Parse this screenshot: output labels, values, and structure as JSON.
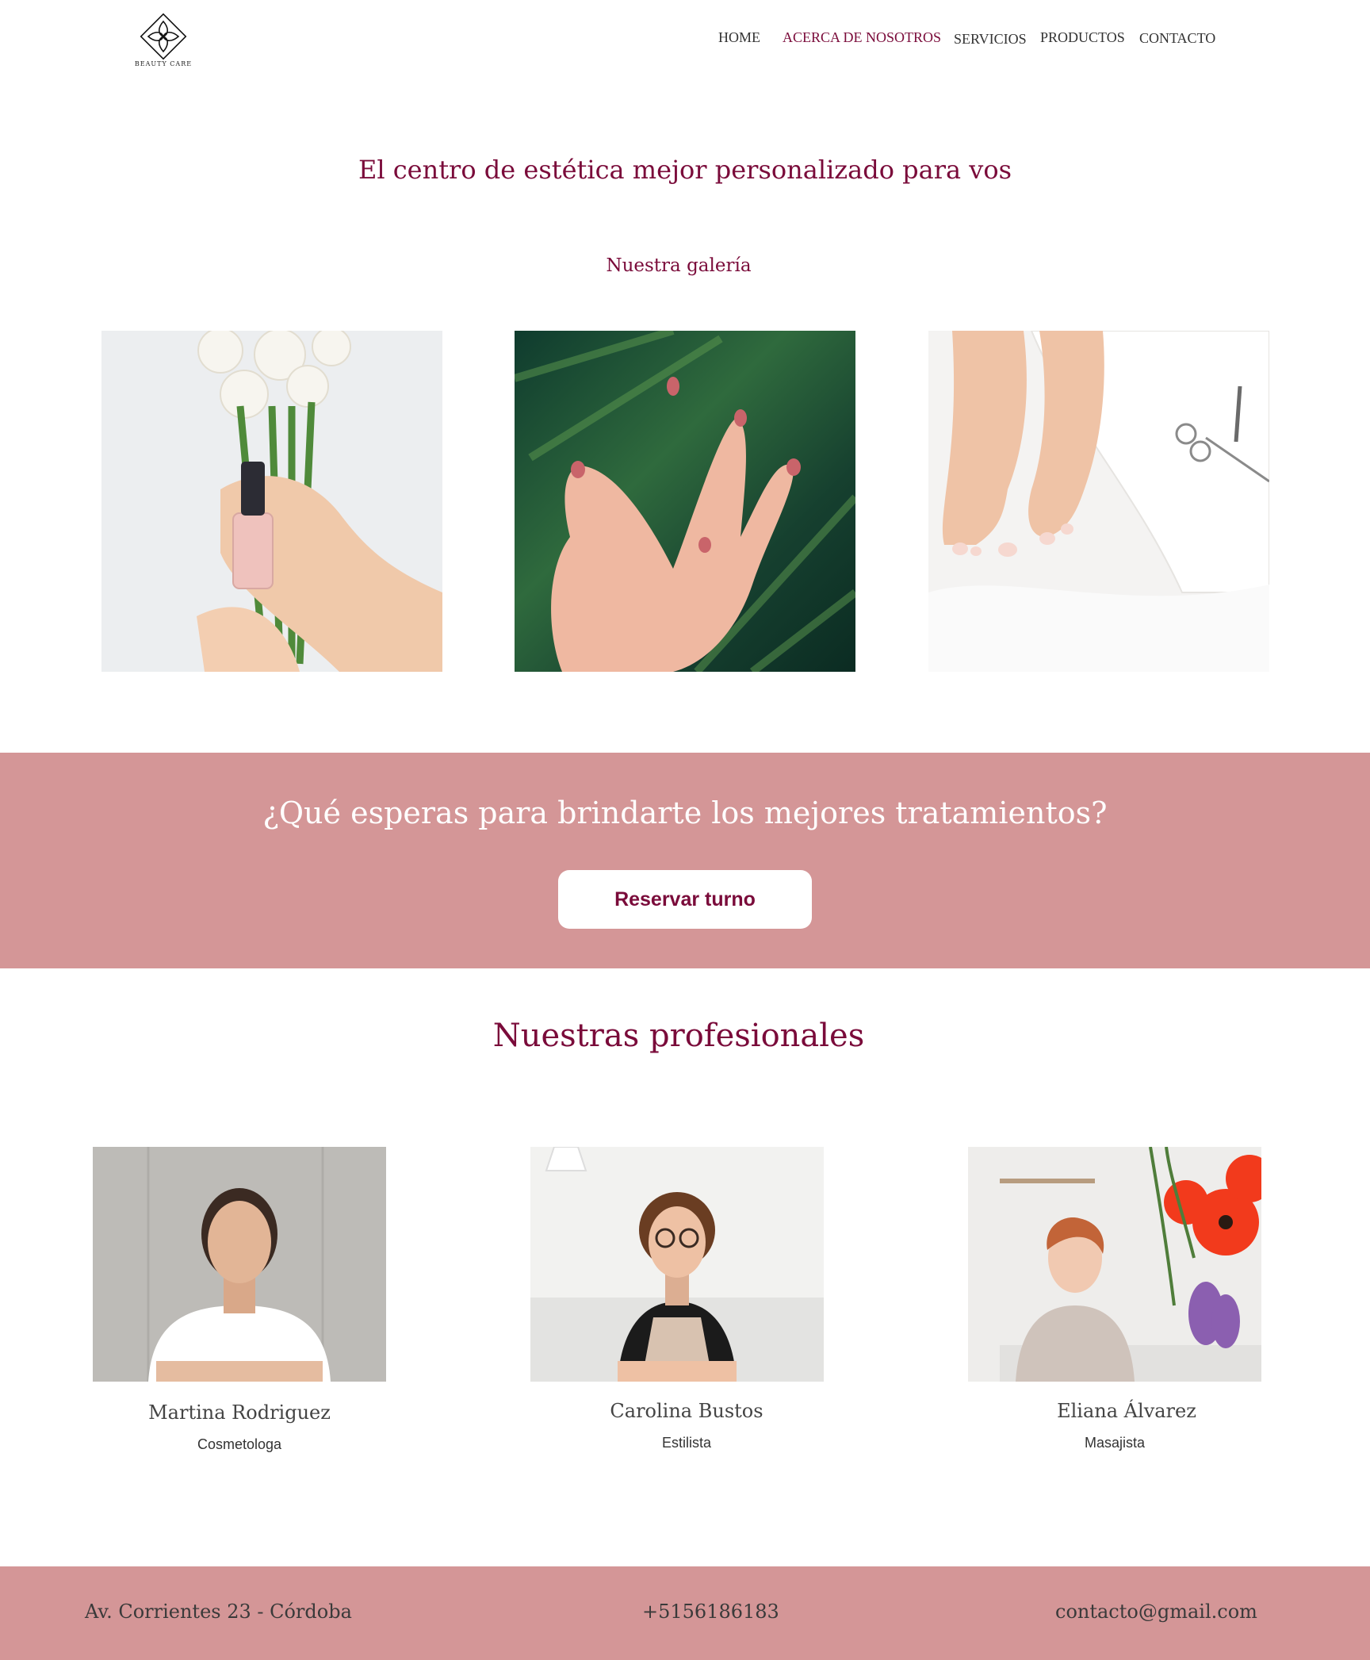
{
  "brand": {
    "logo_text": "BEAUTY CARE"
  },
  "nav": {
    "items": [
      {
        "label": "HOME"
      },
      {
        "label": "ACERCA DE NOSOTROS"
      },
      {
        "label": "SERVICIOS"
      },
      {
        "label": "PRODUCTOS"
      },
      {
        "label": "CONTACTO"
      }
    ],
    "active": "ACERCA DE NOSOTROS"
  },
  "hero": {
    "title": "El centro de estética mejor personalizado para vos"
  },
  "gallery": {
    "title": "Nuestra galería"
  },
  "cta": {
    "title": "¿Qué esperas para brindarte los mejores tratamientos?",
    "button_label": "Reservar turno"
  },
  "professionals": {
    "title": "Nuestras profesionales",
    "people": [
      {
        "name": "Martina Rodriguez",
        "role": "Cosmetologa"
      },
      {
        "name": "Carolina Bustos",
        "role": "Estilista"
      },
      {
        "name": "Eliana Álvarez",
        "role": "Masajista"
      }
    ]
  },
  "footer": {
    "address": "Av. Corrientes 23 - Córdoba",
    "phone": "+5156186183",
    "email": "contacto@gmail.com"
  },
  "colors": {
    "accent": "#7a0b3a",
    "band": "#d49697",
    "background": "#ffffff"
  }
}
